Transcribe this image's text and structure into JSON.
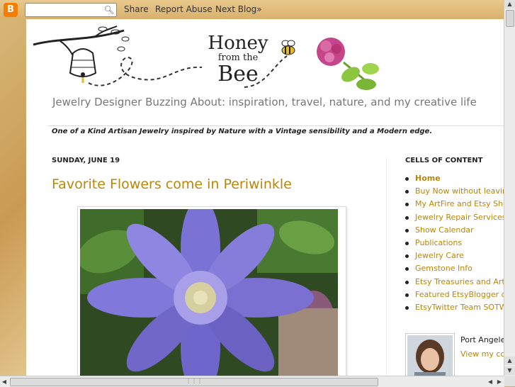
{
  "navbar": {
    "logo": "B",
    "search_placeholder": "",
    "search_icon": "magnifier-icon",
    "links": [
      "Share",
      "Report Abuse",
      "Next Blog»"
    ]
  },
  "blog": {
    "title_line1": "Honey",
    "title_line2": "from the",
    "title_line3": "Bee",
    "description": "Jewelry Designer Buzzing About: inspiration, travel, nature, and my creative life",
    "tagline": "One of a Kind Artisan Jewelry inspired by Nature with a Vintage sensibility and a Modern edge."
  },
  "post": {
    "date": "SUNDAY, JUNE 19",
    "title": "Favorite Flowers come in Periwinkle"
  },
  "sidebar": {
    "title": "CELLS OF CONTENT",
    "items": [
      "Home",
      "Buy Now without leaving D",
      "My ArtFire and Etsy Shops",
      "Jewelry Repair Services",
      "Show Calendar",
      "Publications",
      "Jewelry Care",
      "Gemstone Info",
      "Etsy Treasuries and ArtFir",
      "Featured EtsyBlogger of th",
      "EtsyTwitter Team SOTW"
    ],
    "profile_location": "Port Angeles",
    "profile_link": "View my com"
  },
  "colors": {
    "link": "#b8860b",
    "blogger_orange": "#f57d00"
  }
}
